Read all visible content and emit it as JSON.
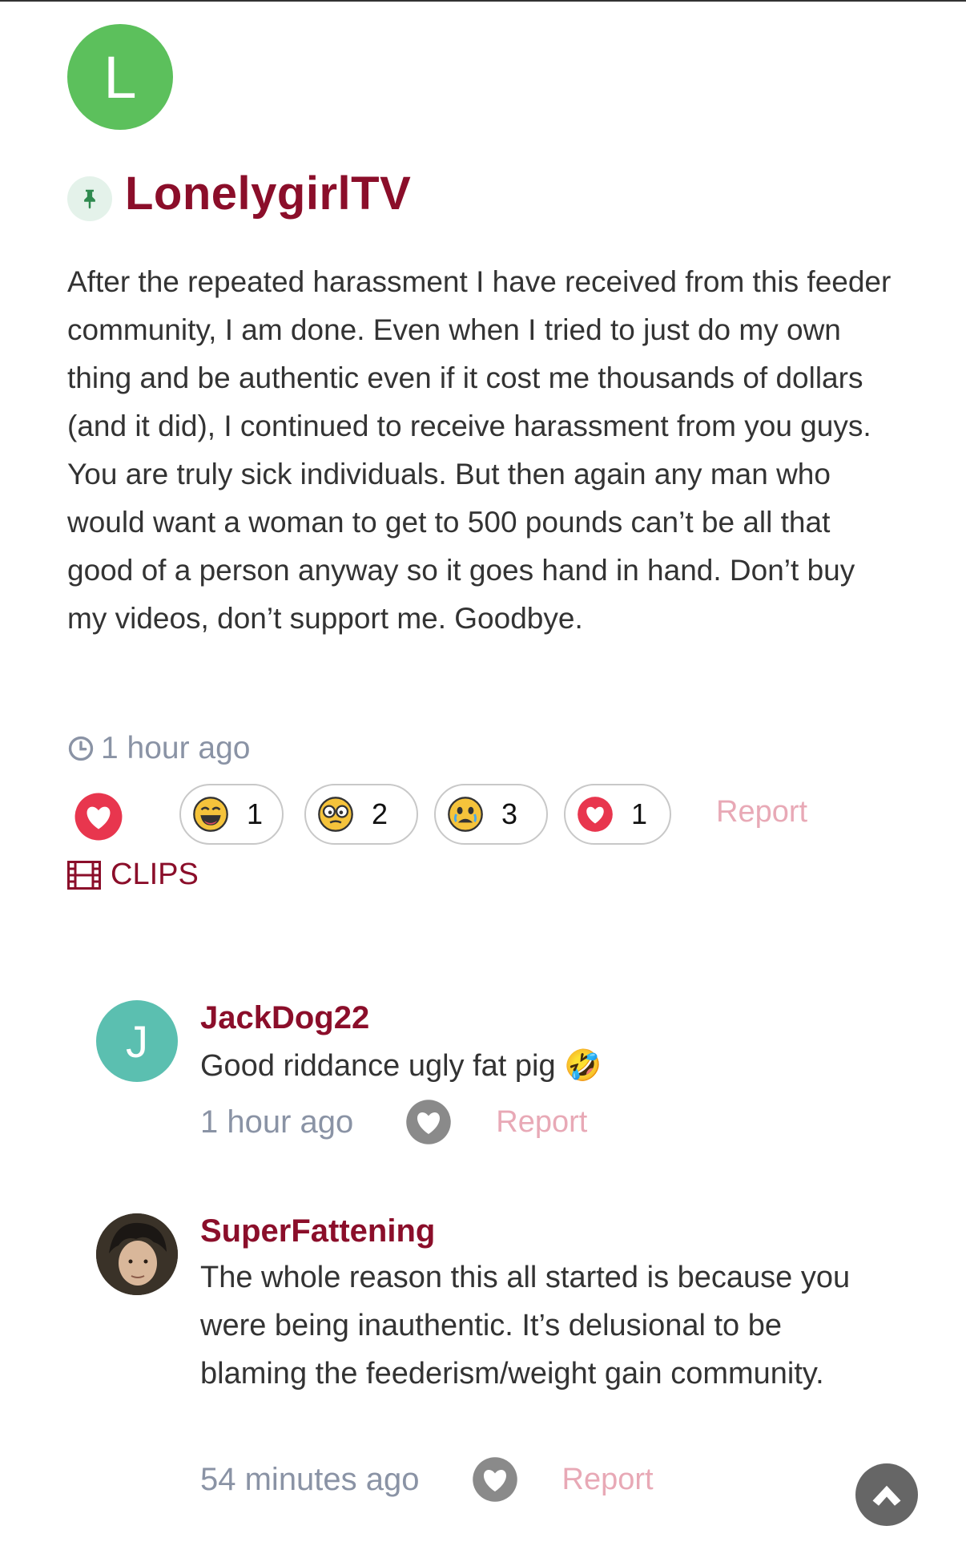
{
  "post": {
    "avatar_letter": "L",
    "author": "LonelygirlTV",
    "body": "After the repeated harassment I have received from this feeder community, I am done. Even when I tried to just do my own thing and be authentic even if it cost me thousands of dollars (and it did), I continued to receive harassment from you guys. You are truly sick individuals. But then again any man who would want a woman to get to 500 pounds can’t be all that good of a person anyway so it goes hand in hand. Don’t buy my videos, don’t support me.  Goodbye.",
    "time": "1 hour ago",
    "reactions": [
      {
        "icon": "laughing-emoji-icon",
        "count": "1"
      },
      {
        "icon": "nerd-emoji-icon",
        "count": "2"
      },
      {
        "icon": "sad-emoji-icon",
        "count": "3"
      },
      {
        "icon": "heart-icon",
        "count": "1"
      }
    ],
    "report_label": "Report",
    "clips_label": "CLIPS"
  },
  "comments": [
    {
      "avatar_letter": "J",
      "author": "JackDog22",
      "text": "Good riddance ugly fat pig 🤣",
      "time": "1 hour ago",
      "report_label": "Report"
    },
    {
      "author": "SuperFattening",
      "text": "The whole reason this all started is because you were being inauthentic. It’s delusional to be blaming the feederism/weight gain community.",
      "time": "54 minutes ago",
      "report_label": "Report"
    }
  ],
  "colors": {
    "accent": "#8b0e2a",
    "avatar_l": "#5cc05c",
    "avatar_j": "#5bbfb0",
    "report": "#e8a9b6",
    "muted": "#8a93a5"
  }
}
